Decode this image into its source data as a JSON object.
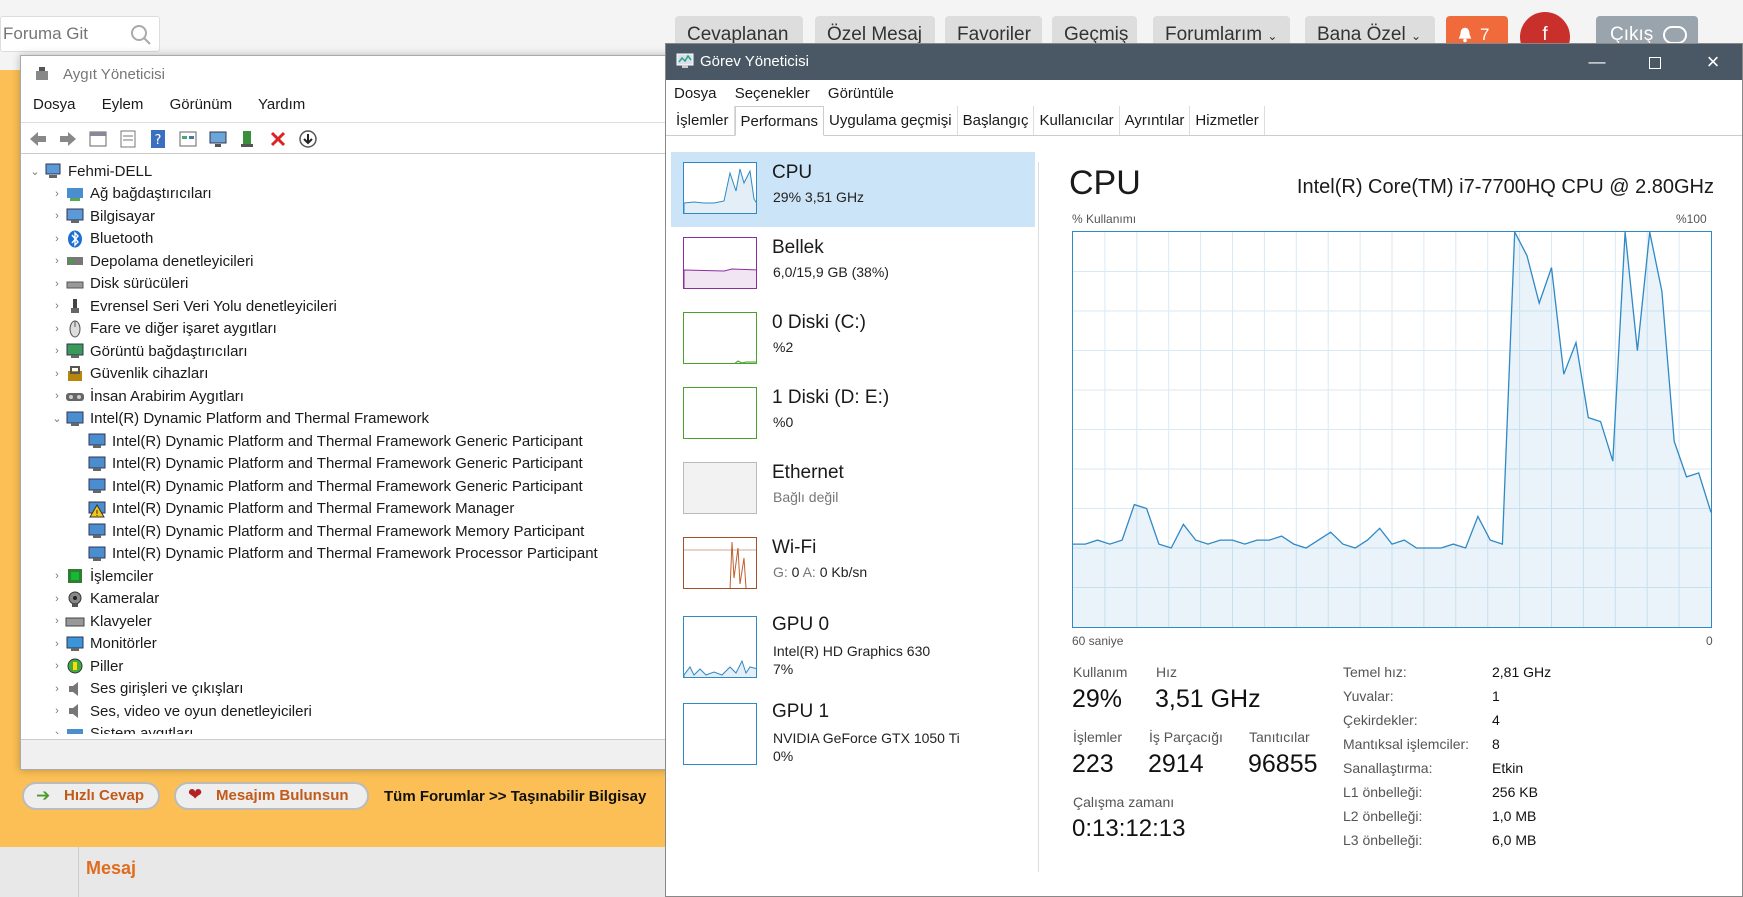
{
  "forum": {
    "search_placeholder": "Foruma Git",
    "nav": [
      "Cevaplanan",
      "Özel Mesaj",
      "Favoriler",
      "Geçmiş",
      "Forumlarım",
      "Bana Özel"
    ],
    "notification_count": "7",
    "avatar_letter": "f",
    "logout_label": "Çıkış",
    "quick_reply": "Hızlı Cevap",
    "message_found": "Mesajım Bulunsun",
    "breadcrumb": "Tüm Forumlar >> Taşınabilir Bilgisay",
    "table_col_message": "Mesaj",
    "accent_color": "#fbbf55"
  },
  "device_manager": {
    "title": "Aygıt Yöneticisi",
    "menu": [
      "Dosya",
      "Eylem",
      "Görünüm",
      "Yardım"
    ],
    "root": "Fehmi-DELL",
    "categories_top": [
      {
        "label": "Ağ bağdaştırıcıları",
        "icon": "network-adapter-icon"
      },
      {
        "label": "Bilgisayar",
        "icon": "computer-icon"
      },
      {
        "label": "Bluetooth",
        "icon": "bluetooth-icon"
      },
      {
        "label": "Depolama denetleyicileri",
        "icon": "storage-controller-icon"
      },
      {
        "label": "Disk sürücüleri",
        "icon": "disk-drive-icon"
      },
      {
        "label": "Evrensel Seri Veri Yolu denetleyicileri",
        "icon": "usb-icon"
      },
      {
        "label": "Fare ve diğer işaret aygıtları",
        "icon": "mouse-icon"
      },
      {
        "label": "Görüntü bağdaştırıcıları",
        "icon": "display-adapter-icon"
      },
      {
        "label": "Güvenlik cihazları",
        "icon": "security-device-icon"
      },
      {
        "label": "İnsan Arabirim Aygıtları",
        "icon": "hid-icon"
      }
    ],
    "expanded_category": "Intel(R) Dynamic Platform and Thermal Framework",
    "expanded_children": [
      {
        "label": "Intel(R) Dynamic Platform and Thermal Framework Generic Participant",
        "warning": false
      },
      {
        "label": "Intel(R) Dynamic Platform and Thermal Framework Generic Participant",
        "warning": false
      },
      {
        "label": "Intel(R) Dynamic Platform and Thermal Framework Generic Participant",
        "warning": false
      },
      {
        "label": "Intel(R) Dynamic Platform and Thermal Framework Manager",
        "warning": true
      },
      {
        "label": "Intel(R) Dynamic Platform and Thermal Framework Memory Participant",
        "warning": false
      },
      {
        "label": "Intel(R) Dynamic Platform and Thermal Framework Processor Participant",
        "warning": false
      }
    ],
    "categories_bottom": [
      {
        "label": "İşlemciler",
        "icon": "processor-icon"
      },
      {
        "label": "Kameralar",
        "icon": "camera-icon"
      },
      {
        "label": "Klavyeler",
        "icon": "keyboard-icon"
      },
      {
        "label": "Monitörler",
        "icon": "monitor-icon"
      },
      {
        "label": "Piller",
        "icon": "battery-icon"
      },
      {
        "label": "Ses girişleri ve çıkışları",
        "icon": "audio-io-icon"
      },
      {
        "label": "Ses, video ve oyun denetleyicileri",
        "icon": "sound-controller-icon"
      },
      {
        "label": "Sistem aygıtları",
        "icon": "system-device-icon"
      }
    ]
  },
  "task_manager": {
    "title": "Görev Yöneticisi",
    "menu": [
      "Dosya",
      "Seçenekler",
      "Görüntüle"
    ],
    "tabs": [
      "İşlemler",
      "Performans",
      "Uygulama geçmişi",
      "Başlangıç",
      "Kullanıcılar",
      "Ayrıntılar",
      "Hizmetler"
    ],
    "active_tab": 1,
    "sidebar": [
      {
        "name": "CPU",
        "sub1": "29%  3,51 GHz",
        "sub2": "",
        "color": "#2f89c5"
      },
      {
        "name": "Bellek",
        "sub1": "6,0/15,9 GB (38%)",
        "sub2": "",
        "color": "#8b2f9e"
      },
      {
        "name": "0 Diski (C:)",
        "sub1": "%2",
        "sub2": "",
        "color": "#4aa02c"
      },
      {
        "name": "1 Diski (D: E:)",
        "sub1": "%0",
        "sub2": "",
        "color": "#4aa02c"
      },
      {
        "name": "Ethernet",
        "sub1": "Bağlı değil",
        "sub2": "",
        "color": "#aaaaaa"
      },
      {
        "name": "Wi-Fi",
        "sub1_g": "G:",
        "sub1_gv": "0",
        "sub1_a": "A:",
        "sub1_av": "0 Kb/sn",
        "color": "#a0522d"
      },
      {
        "name": "GPU 0",
        "sub1": "Intel(R) HD Graphics 630",
        "sub2": "7%",
        "color": "#2f89c5"
      },
      {
        "name": "GPU 1",
        "sub1": "NVIDIA GeForce GTX 1050 Ti",
        "sub2": "0%",
        "color": "#2f89c5"
      }
    ],
    "cpu": {
      "heading": "CPU",
      "model": "Intel(R) Core(TM) i7-7700HQ CPU @ 2.80GHz",
      "graph_label_left": "% Kullanımı",
      "graph_label_right": "%100",
      "axis_left": "60 saniye",
      "axis_right": "0",
      "usage_label": "Kullanım",
      "usage_value": "29%",
      "speed_label": "Hız",
      "speed_value": "3,51 GHz",
      "proc_label": "İşlemler",
      "proc_value": "223",
      "threads_label": "İş Parçacığı",
      "threads_value": "2914",
      "handles_label": "Tanıtıcılar",
      "handles_value": "96855",
      "uptime_label": "Çalışma zamanı",
      "uptime_value": "0:13:12:13",
      "specs": [
        {
          "k": "Temel hız:",
          "v": "2,81 GHz"
        },
        {
          "k": "Yuvalar:",
          "v": "1"
        },
        {
          "k": "Çekirdekler:",
          "v": "4"
        },
        {
          "k": "Mantıksal işlemciler:",
          "v": "8"
        },
        {
          "k": "Sanallaştırma:",
          "v": "Etkin"
        },
        {
          "k": "L1 önbelleği:",
          "v": "256 KB"
        },
        {
          "k": "L2 önbelleği:",
          "v": "1,0 MB"
        },
        {
          "k": "L3 önbelleği:",
          "v": "6,0 MB"
        }
      ]
    }
  },
  "chart_data": {
    "type": "area",
    "title": "CPU",
    "xlabel": "60 saniye",
    "ylabel": "% Kullanımı",
    "xlim": [
      60,
      0
    ],
    "ylim": [
      0,
      100
    ],
    "grid": true,
    "series": [
      {
        "values": [
          21,
          21,
          22,
          21,
          22,
          31,
          30,
          21,
          20,
          26,
          22,
          21,
          22,
          22,
          21,
          22,
          22,
          23,
          21,
          20,
          22,
          24,
          21,
          20,
          22,
          25,
          21,
          22,
          20,
          20,
          20,
          21,
          20,
          28,
          22,
          21,
          100,
          94,
          82,
          91,
          64,
          72,
          53,
          52,
          42,
          100,
          70,
          100,
          85,
          47,
          38,
          39,
          29
        ]
      }
    ]
  }
}
